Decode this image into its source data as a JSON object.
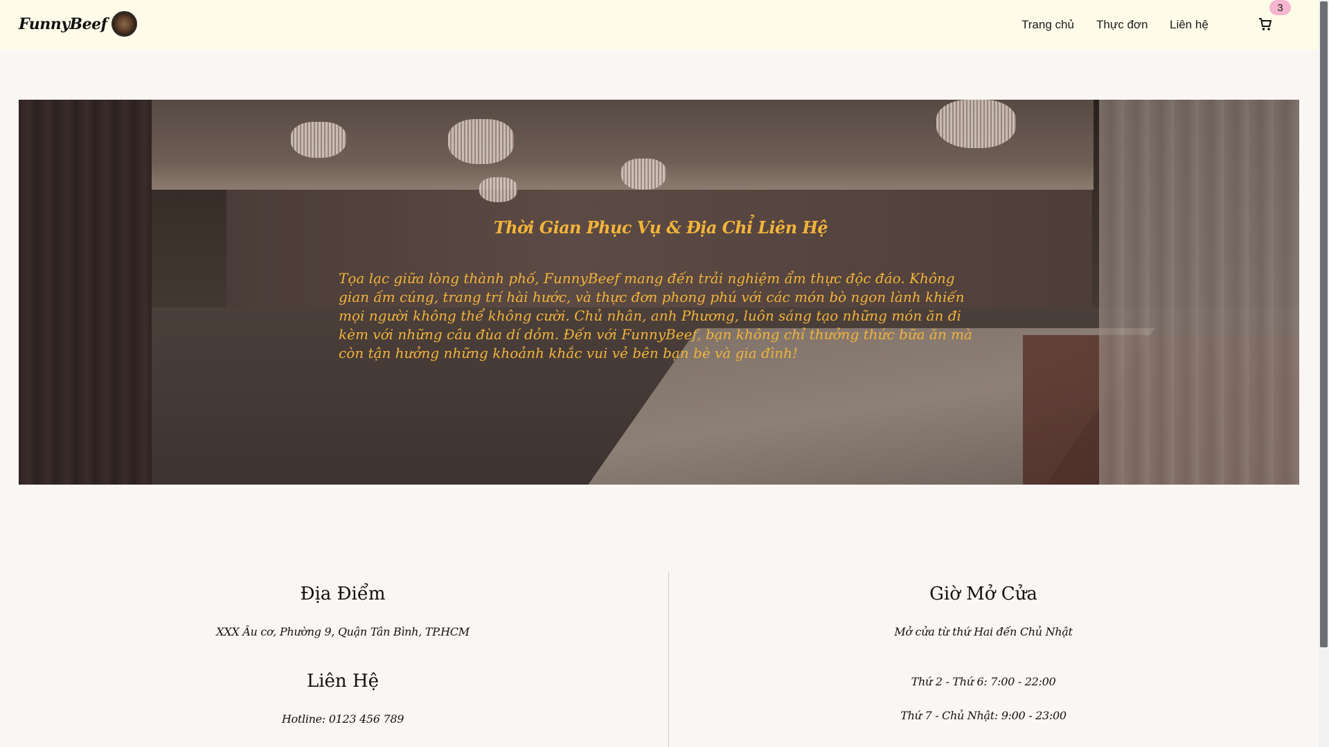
{
  "header": {
    "brand_name": "FunnyBeef",
    "nav": [
      "Trang chủ",
      "Thực đơn",
      "Liên hệ"
    ],
    "cart_count": "3",
    "background": "#fefbe9"
  },
  "hero": {
    "title": "Thời Gian Phục Vụ & Địa Chỉ Liên Hệ",
    "text": "Tọa lạc giữa lòng thành phố, FunnyBeef mang đến trải nghiệm ẩm thực độc đáo. Không gian ấm cúng, trang trí hài hước, và thực đơn phong phú với các món bò ngon lành khiến mọi người không thể không cười. Chủ nhân, anh Phương, luôn sáng tạo những món ăn đi kèm với những câu đùa dí dỏm. Đến với FunnyBeef, bạn không chỉ thưởng thức bữa ăn mà còn tận hưởng những khoảnh khắc vui vẻ bên bạn bè và gia đình!",
    "text_color": "#f3b43a"
  },
  "location": {
    "title": "Địa Điểm",
    "address": "XXX Âu cơ, Phường 9, Quận Tân Bình, TP.HCM"
  },
  "contact": {
    "title": "Liên Hệ",
    "hotline": "Hotline: 0123 456 789"
  },
  "hours": {
    "title": "Giờ Mở Cửa",
    "summary": "Mở cửa từ thứ Hai đến Chủ Nhật",
    "weekday": "Thứ 2 - Thứ 6: 7:00 - 22:00",
    "weekend": "Thứ 7 - Chủ Nhật: 9:00 - 23:00"
  }
}
